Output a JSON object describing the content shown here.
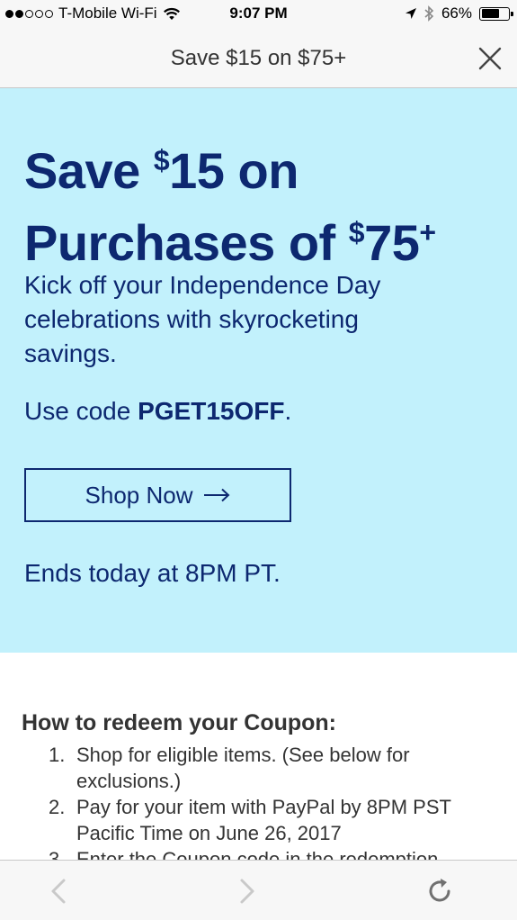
{
  "status_bar": {
    "carrier": "T-Mobile Wi-Fi",
    "time": "9:07 PM",
    "battery_percent": "66%",
    "battery_level": 0.66,
    "signal_bars_filled": 2,
    "signal_bars_total": 5
  },
  "title_bar": {
    "title": "Save $15 on $75+"
  },
  "hero": {
    "background_color": "#c2f1fc",
    "text_color": "#0d2870",
    "headline_line1_pre": "Save ",
    "headline_line1_sup": "$",
    "headline_line1_post": "15 on",
    "headline_line2_pre": "Purchases of ",
    "headline_line2_sup": "$",
    "headline_line2_amount": "75",
    "headline_line2_sup_plus": "+",
    "description": "Kick off your Independence Day celebrations with skyrocketing savings.",
    "code_prefix": "Use code ",
    "code": "PGET15OFF",
    "code_suffix": ".",
    "shop_button_label": "Shop Now",
    "ends_text": "Ends today at 8PM PT."
  },
  "redeem": {
    "heading": "How to redeem your Coupon:",
    "steps": [
      {
        "num": "1.",
        "text": "Shop for eligible items. (See below for exclusions.)"
      },
      {
        "num": "2.",
        "text": "Pay for your item with PayPal by 8PM PST Pacific Time on June 26, 2017"
      },
      {
        "num": "3.",
        "text": "Enter the Coupon code in the redemption"
      }
    ]
  },
  "toolbar": {
    "icons": [
      "back-arrow-icon",
      "forward-arrow-icon",
      "reload-icon"
    ]
  }
}
